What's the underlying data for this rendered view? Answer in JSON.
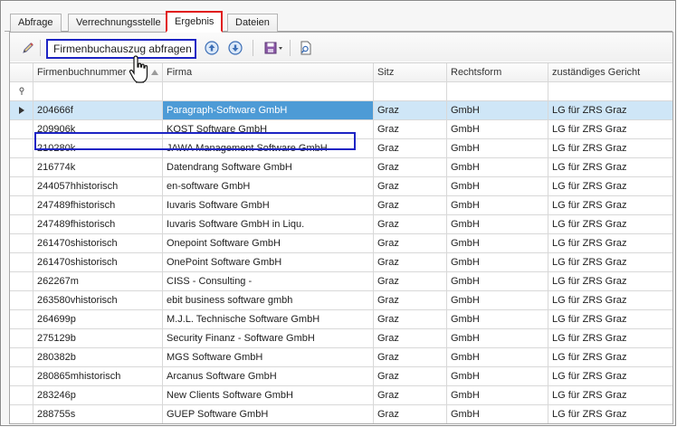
{
  "tabs": [
    {
      "label": "Abfrage",
      "active": false
    },
    {
      "label": "Verrechnungsstelle",
      "active": false
    },
    {
      "label": "Ergebnis",
      "active": true
    },
    {
      "label": "Dateien",
      "active": false
    }
  ],
  "toolbar": {
    "edit_icon": "pencil-icon",
    "query_button_label": "Firmenbuchauszug abfragen",
    "up_icon": "arrow-up-circle-icon",
    "down_icon": "arrow-down-circle-icon",
    "export_icon": "save-dropdown-icon",
    "search_icon": "document-search-icon"
  },
  "colors": {
    "active_tab_border": "#e11b1b",
    "highlight_border": "#1d24c4",
    "selected_row": "#cfe6f7",
    "selected_cell": "#4d9bd6"
  },
  "grid": {
    "columns": [
      "Firmenbuchnummer",
      "Firma",
      "Sitz",
      "Rechtsform",
      "zuständiges Gericht"
    ],
    "sorted_column": "Firmenbuchnummer",
    "selected_row_index": 0,
    "rows": [
      [
        "204666f",
        "Paragraph-Software GmbH",
        "Graz",
        "GmbH",
        "LG für ZRS Graz"
      ],
      [
        "209906k",
        "KOST Software GmbH",
        "Graz",
        "GmbH",
        "LG für ZRS Graz"
      ],
      [
        "210280k",
        "JAWA Management Software GmbH",
        "Graz",
        "GmbH",
        "LG für ZRS Graz"
      ],
      [
        "216774k",
        "Datendrang Software GmbH",
        "Graz",
        "GmbH",
        "LG für ZRS Graz"
      ],
      [
        "244057hhistorisch",
        "en-software GmbH",
        "Graz",
        "GmbH",
        "LG für ZRS Graz"
      ],
      [
        "247489fhistorisch",
        "Iuvaris Software GmbH",
        "Graz",
        "GmbH",
        "LG für ZRS Graz"
      ],
      [
        "247489fhistorisch",
        "Iuvaris Software GmbH in Liqu.",
        "Graz",
        "GmbH",
        "LG für ZRS Graz"
      ],
      [
        "261470shistorisch",
        "Onepoint Software GmbH",
        "Graz",
        "GmbH",
        "LG für ZRS Graz"
      ],
      [
        "261470shistorisch",
        "OnePoint Software GmbH",
        "Graz",
        "GmbH",
        "LG für ZRS Graz"
      ],
      [
        "262267m",
        "CISS - Consulting -",
        "Graz",
        "GmbH",
        "LG für ZRS Graz"
      ],
      [
        "263580vhistorisch",
        "ebit business software gmbh",
        "Graz",
        "GmbH",
        "LG für ZRS Graz"
      ],
      [
        "264699p",
        "M.J.L. Technische Software GmbH",
        "Graz",
        "GmbH",
        "LG für ZRS Graz"
      ],
      [
        "275129b",
        "Security Finanz - Software GmbH",
        "Graz",
        "GmbH",
        "LG für ZRS Graz"
      ],
      [
        "280382b",
        "MGS Software GmbH",
        "Graz",
        "GmbH",
        "LG für ZRS Graz"
      ],
      [
        "280865mhistorisch",
        "Arcanus Software GmbH",
        "Graz",
        "GmbH",
        "LG für ZRS Graz"
      ],
      [
        "283246p",
        "New Clients Software GmbH",
        "Graz",
        "GmbH",
        "LG für ZRS Graz"
      ],
      [
        "288755s",
        "GUEP Software GmbH",
        "Graz",
        "GmbH",
        "LG für ZRS Graz"
      ]
    ]
  }
}
